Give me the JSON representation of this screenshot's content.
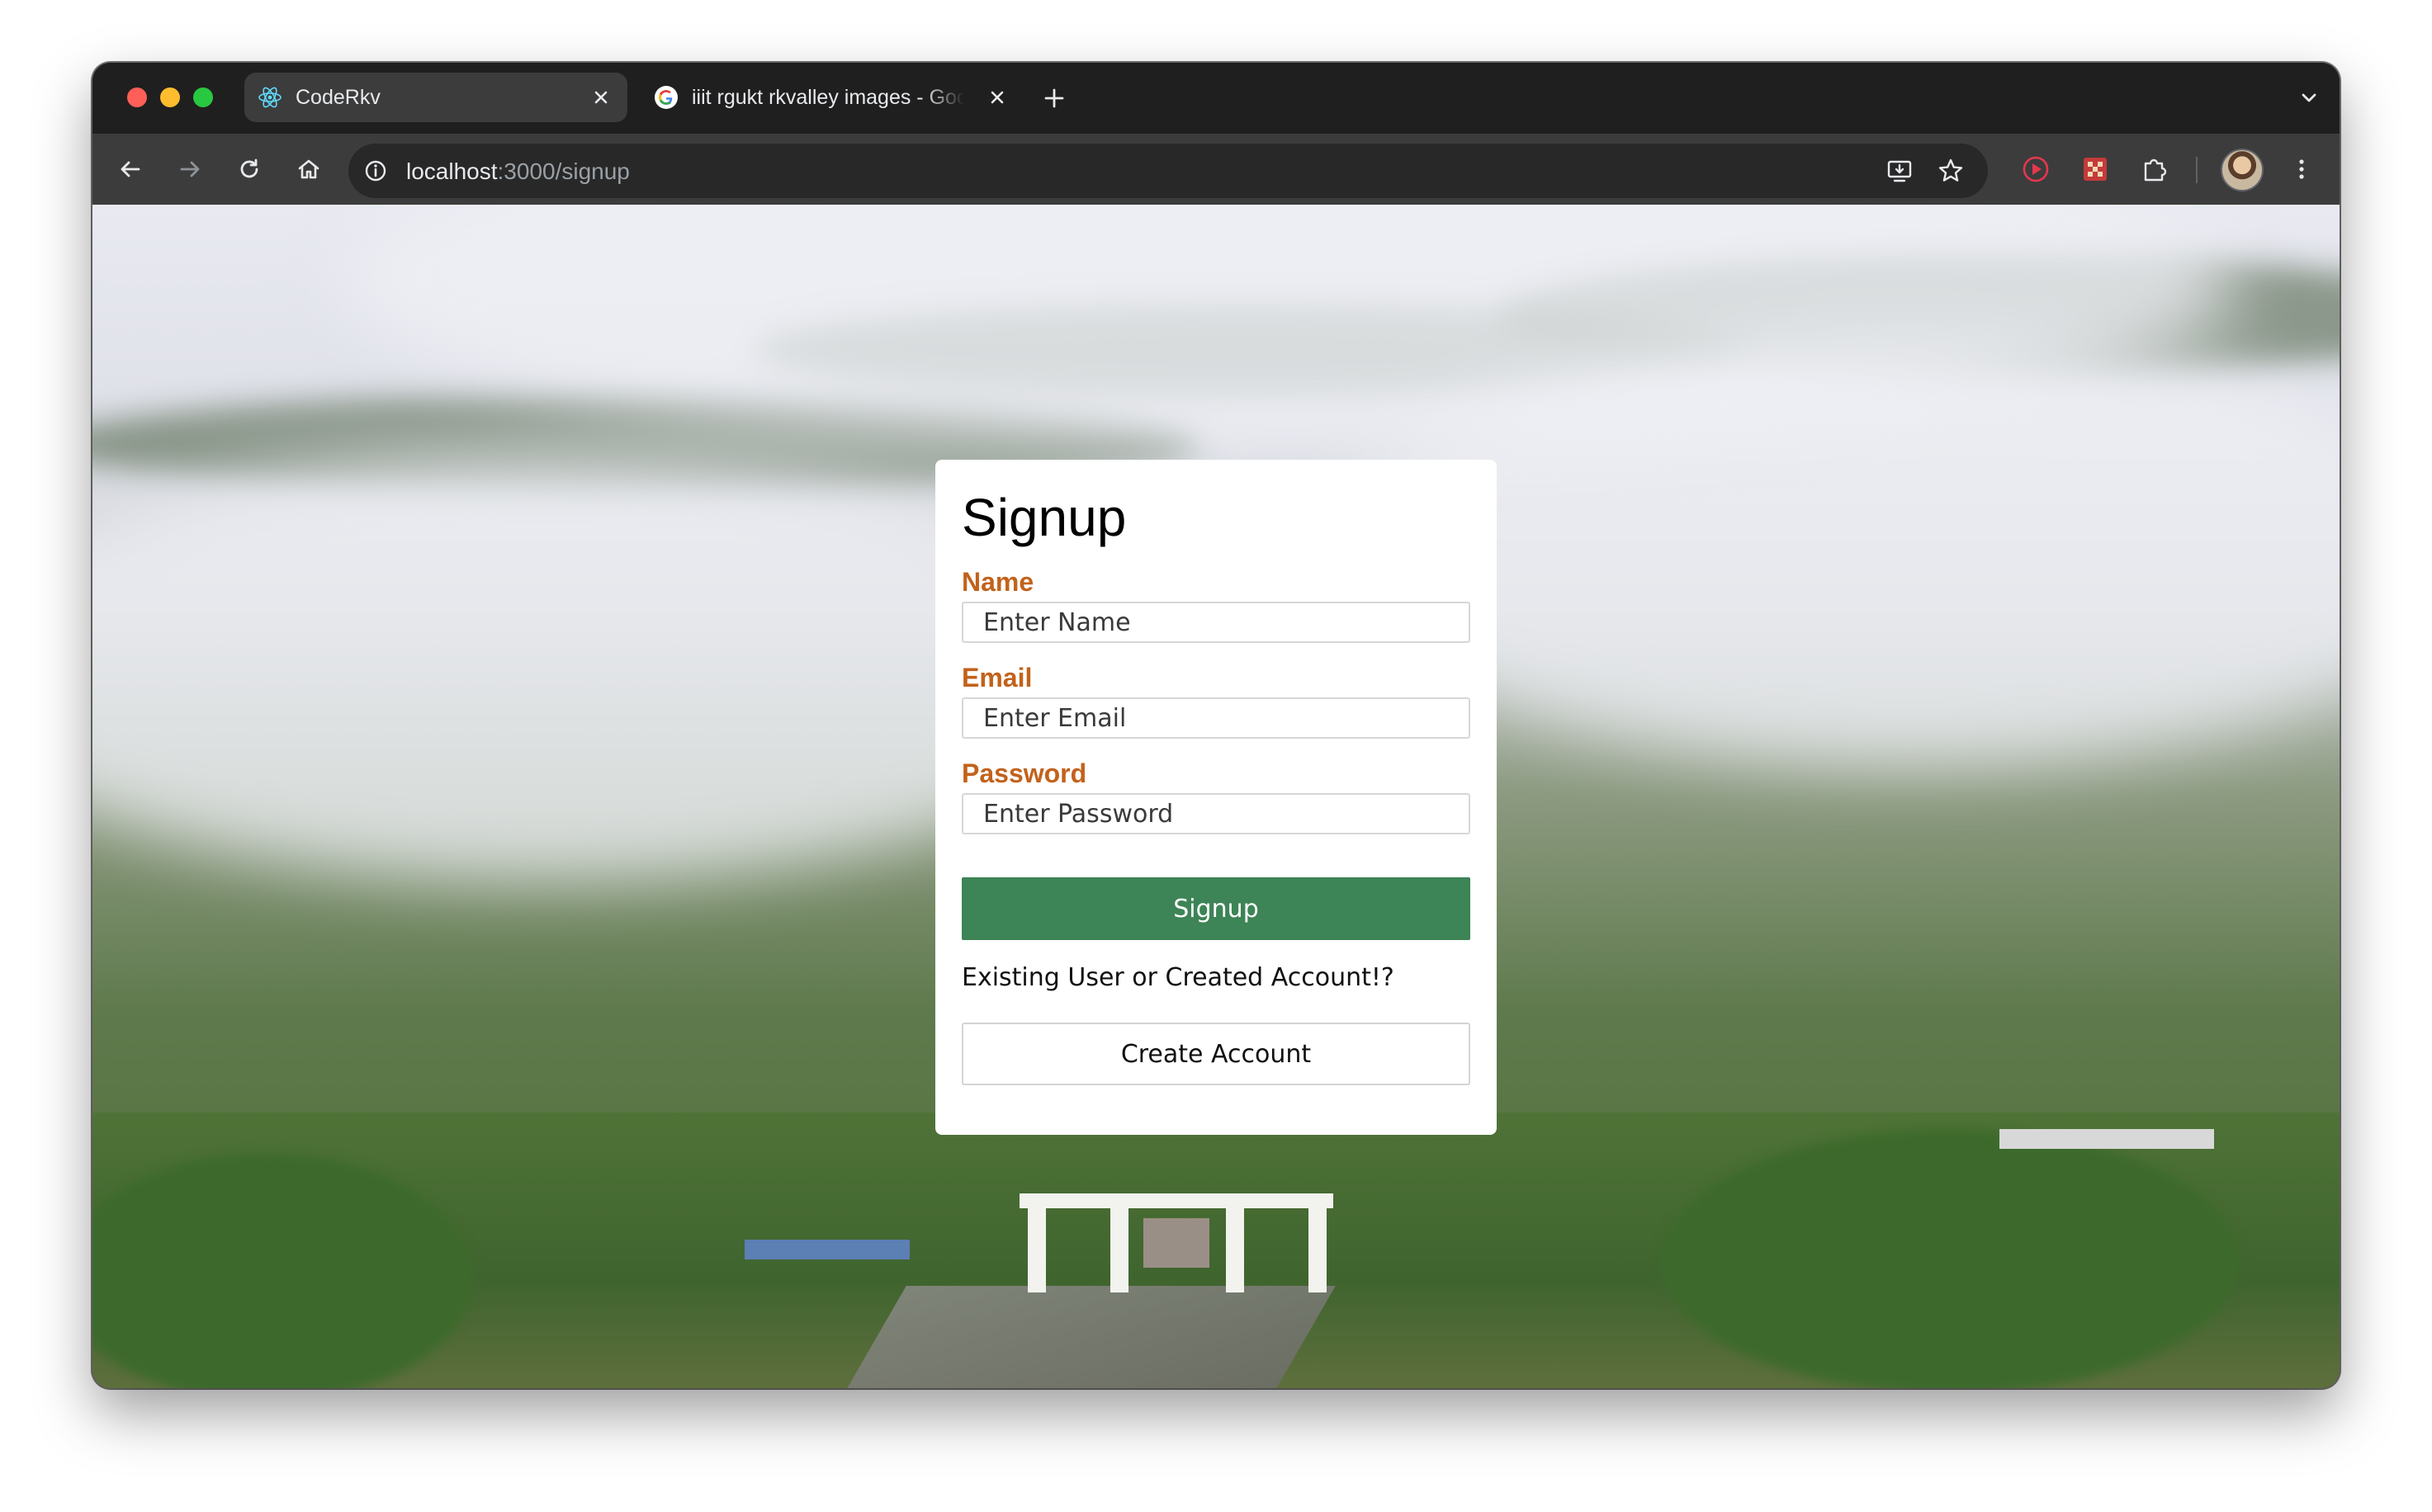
{
  "browser": {
    "tabs": [
      {
        "title": "CodeRkv",
        "icon": "react-icon",
        "active": true
      },
      {
        "title": "iiit rgukt rkvalley images - Google Search",
        "icon": "google-icon",
        "active": false
      }
    ],
    "address_bar": {
      "host": "localhost",
      "path": ":3000/signup"
    }
  },
  "signup_card": {
    "title": "Signup",
    "fields": [
      {
        "label": "Name",
        "placeholder": "Enter Name"
      },
      {
        "label": "Email",
        "placeholder": "Enter Email"
      },
      {
        "label": "Password",
        "placeholder": "Enter Password"
      }
    ],
    "submit_label": "Signup",
    "helper_text": "Existing User or Created Account!?",
    "secondary_label": "Create Account"
  },
  "colors": {
    "label": "#c2621b",
    "primary_button": "#3d8456",
    "card_background": "#ffffff",
    "browser_chrome": "#3c3c3c"
  }
}
